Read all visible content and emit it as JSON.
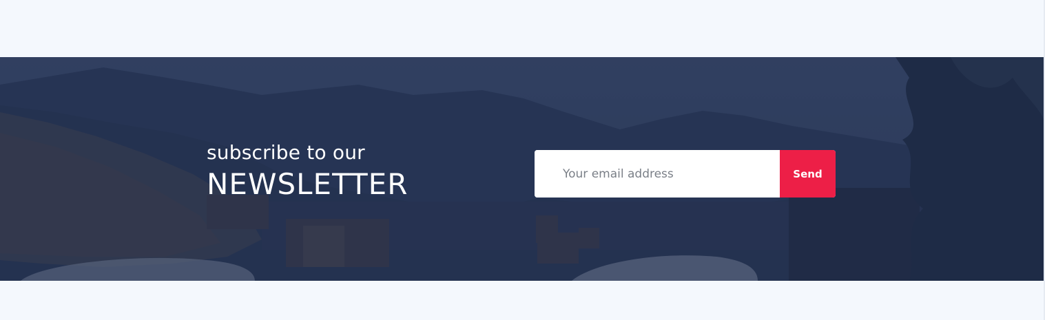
{
  "newsletter": {
    "subtitle": "subscribe to our",
    "title": "NEWSLETTER",
    "email_placeholder": "Your email address",
    "email_value": "",
    "send_label": "Send"
  },
  "colors": {
    "page_background": "#f4f8fd",
    "overlay": "#25355a",
    "send_button": "#ed1f47",
    "input_background": "#ffffff"
  },
  "banner_image": {
    "description_icon": "mountain-landscape-image"
  }
}
